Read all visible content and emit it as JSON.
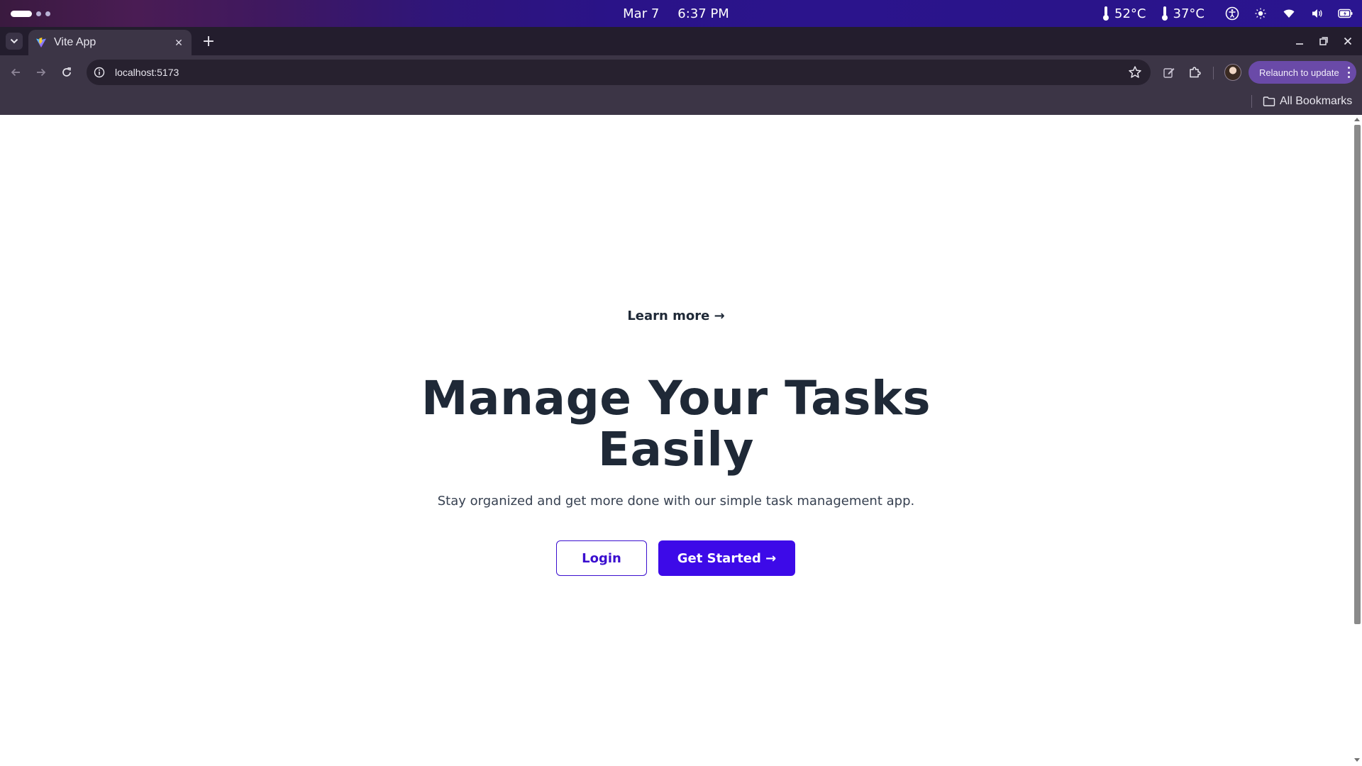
{
  "os_bar": {
    "date": "Mar 7",
    "time": "6:37 PM",
    "temp_cpu": "52°C",
    "temp_other": "37°C",
    "icons": [
      "thermometer-icon",
      "accessibility-icon",
      "brightness-icon",
      "wifi-icon",
      "volume-icon",
      "battery-icon"
    ]
  },
  "browser": {
    "tab": {
      "title": "Vite App",
      "favicon": "vite-logo-icon"
    },
    "new_tab_symbol": "+",
    "close_tab_symbol": "✕",
    "address": "localhost:5173",
    "relaunch_label": "Relaunch to update",
    "bookmarks_label": "All Bookmarks"
  },
  "page": {
    "learn_more": "Learn more →",
    "headline_line1": "Manage Your Tasks",
    "headline_line2": "Easily",
    "subtext": "Stay organized and get more done with our simple task management app.",
    "login_label": "Login",
    "get_started_label": "Get Started →",
    "colors": {
      "primary": "#3d0ae8",
      "heading": "#1f2937",
      "body": "#374151"
    }
  }
}
